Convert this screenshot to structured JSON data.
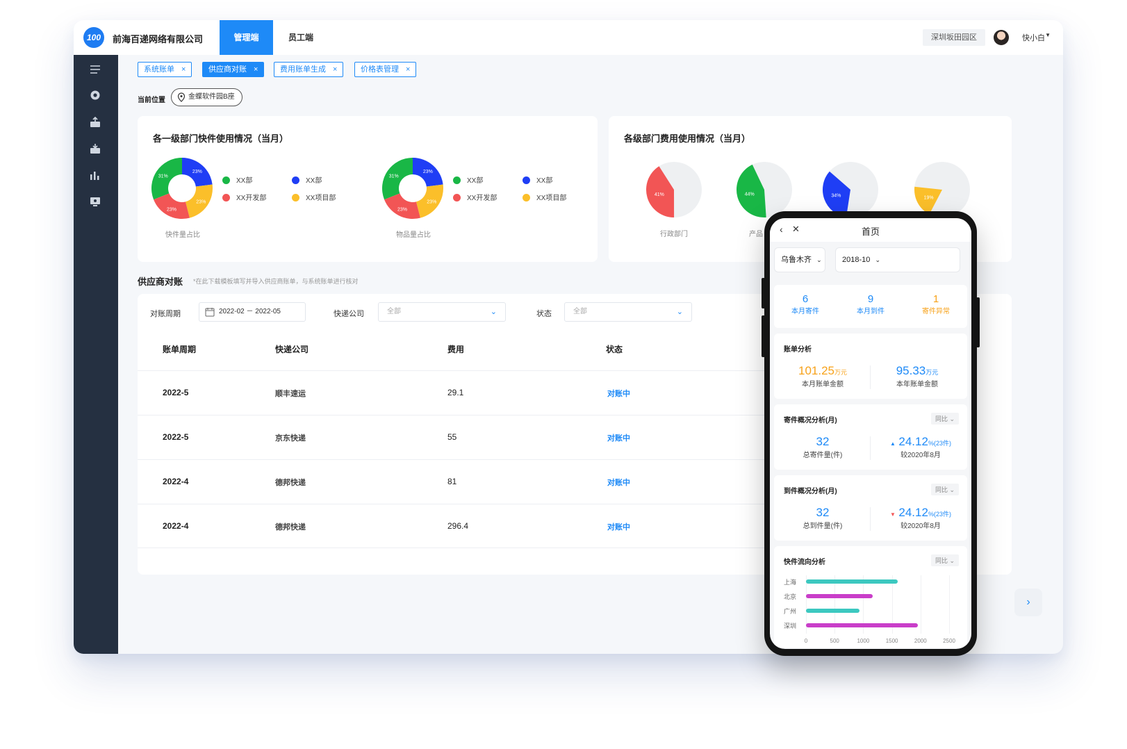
{
  "app": {
    "company": "前海百递网络有限公司",
    "logo_text": "100",
    "nav_tabs": [
      "管理端",
      "员工端"
    ],
    "region": "深圳坂田园区",
    "user": "快小白"
  },
  "tabs": [
    {
      "label": "系统账单",
      "active": false
    },
    {
      "label": "供应商对账",
      "active": true
    },
    {
      "label": "费用账单生成",
      "active": false
    },
    {
      "label": "价格表管理",
      "active": false
    }
  ],
  "location": {
    "label": "当前位置",
    "value": "金蝶软件园B座"
  },
  "dept_usage": {
    "title": "各一级部门快件使用情况（当月）",
    "legend": [
      "XX部",
      "XX部",
      "XX开发部",
      "XX项目部"
    ],
    "donut1": {
      "caption": "快件量占比",
      "chart_data": {
        "type": "pie",
        "values": [
          31,
          23,
          23,
          23
        ],
        "labels": [
          "31%",
          "23%",
          "23%",
          "23%"
        ],
        "colors": [
          "#19b746",
          "#1f3ef5",
          "#fbbf2a",
          "#f25555"
        ]
      }
    },
    "donut2": {
      "caption": "物品量占比",
      "chart_data": {
        "type": "pie",
        "values": [
          31,
          23,
          23,
          23
        ],
        "labels": [
          "31%",
          "23%",
          "23%",
          "23%"
        ],
        "colors": [
          "#19b746",
          "#1f3ef5",
          "#fbbf2a",
          "#f25555"
        ]
      }
    }
  },
  "dept_cost": {
    "title": "各级部门费用使用情况（当月）",
    "pies": [
      {
        "name": "行政部门",
        "pct_label": "41%",
        "value": 41,
        "color": "#f25555"
      },
      {
        "name": "产品",
        "pct_label": "44%",
        "value": 44,
        "color": "#19b746"
      },
      {
        "name": "",
        "pct_label": "34%",
        "value": 34,
        "color": "#1f3ef5"
      },
      {
        "name": "",
        "pct_label": "19%",
        "value": 19,
        "color": "#fbbf2a"
      }
    ]
  },
  "reconcile": {
    "title": "供应商对账",
    "note": "*在此下载模板填写并导入供应商账单，与系统账单进行核对",
    "filters": {
      "period_label": "对账周期",
      "period_value": "2022-02  －  2022-05",
      "company_label": "快递公司",
      "company_placeholder": "全部",
      "status_label": "状态",
      "status_placeholder": "全部"
    },
    "columns": [
      "账单周期",
      "快递公司",
      "费用",
      "状态"
    ],
    "rows": [
      {
        "period": "2022-5",
        "company": "顺丰速运",
        "fee": "29.1",
        "status": "对账中"
      },
      {
        "period": "2022-5",
        "company": "京东快递",
        "fee": "55",
        "status": "对账中"
      },
      {
        "period": "2022-4",
        "company": "德邦快递",
        "fee": "81",
        "status": "对账中"
      },
      {
        "period": "2022-4",
        "company": "德邦快递",
        "fee": "296.4",
        "status": "对账中"
      }
    ]
  },
  "mobile": {
    "title": "首页",
    "city": "乌鲁木齐",
    "month": "2018-10",
    "stats": [
      {
        "value": "6",
        "label": "本月寄件"
      },
      {
        "value": "9",
        "label": "本月到件"
      },
      {
        "value": "1",
        "label": "寄件异常"
      }
    ],
    "bill": {
      "title": "账单分析",
      "month_value": "101.25",
      "month_unit": "万元",
      "month_label": "本月账单金额",
      "year_value": "95.33",
      "year_unit": "万元",
      "year_label": "本年账单金额"
    },
    "send": {
      "title": "寄件概况分析(月)",
      "compare": "同比",
      "total": "32",
      "total_label": "总寄件量(件)",
      "pct": "24.12",
      "pct_unit": "%",
      "pct_extra": "(23件)",
      "pct_label": "较2020年8月"
    },
    "receive": {
      "title": "到件概况分析(月)",
      "compare": "同比",
      "total": "32",
      "total_label": "总到件量(件)",
      "pct": "24.12",
      "pct_unit": "%",
      "pct_extra": "(23件)",
      "pct_label": "较2020年8月"
    },
    "flow": {
      "title": "快件流向分析",
      "compare": "同比",
      "chart_data": {
        "type": "bar",
        "orientation": "horizontal",
        "categories": [
          "上海",
          "北京",
          "广州",
          "深圳"
        ],
        "values": [
          1600,
          1170,
          940,
          1950
        ],
        "colors": [
          "#3cc8c0",
          "#c93ec9",
          "#3cc8c0",
          "#c93ec9"
        ],
        "xticks": [
          "0",
          "500",
          "1000",
          "1500",
          "2000",
          "2500"
        ],
        "xlim": [
          0,
          2500
        ]
      }
    }
  }
}
